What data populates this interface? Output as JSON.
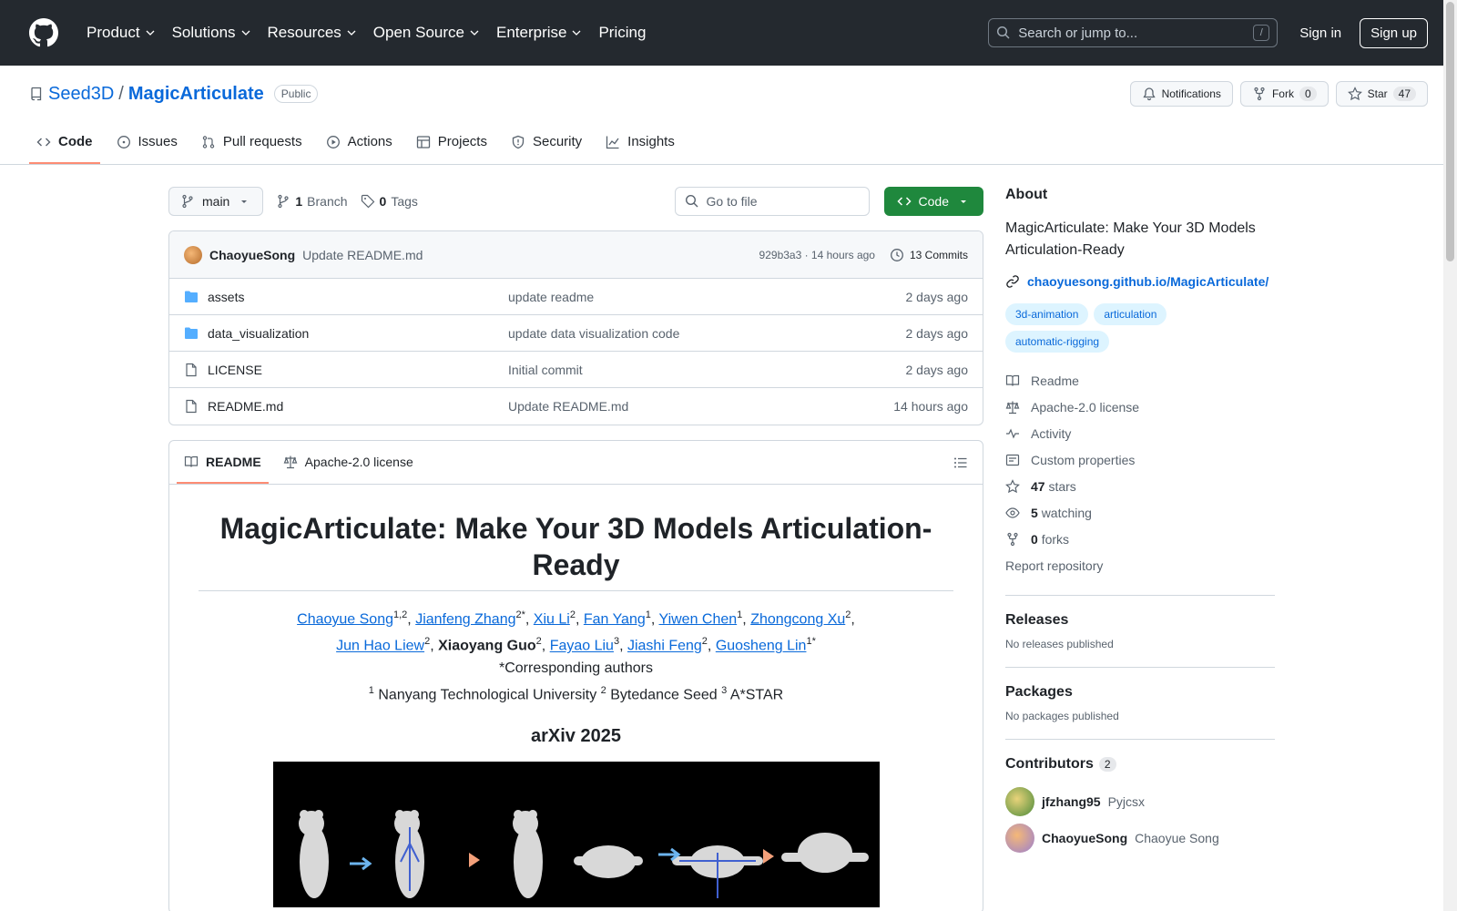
{
  "header": {
    "nav": [
      "Product",
      "Solutions",
      "Resources",
      "Open Source",
      "Enterprise",
      "Pricing"
    ],
    "search_placeholder": "Search or jump to...",
    "search_key": "/",
    "sign_in": "Sign in",
    "sign_up": "Sign up"
  },
  "repo": {
    "owner": "Seed3D",
    "sep": "/",
    "name": "MagicArticulate",
    "visibility": "Public",
    "notifications": "Notifications",
    "fork_label": "Fork",
    "fork_count": "0",
    "star_label": "Star",
    "star_count": "47"
  },
  "tabs": [
    "Code",
    "Issues",
    "Pull requests",
    "Actions",
    "Projects",
    "Security",
    "Insights"
  ],
  "filenav": {
    "branch": "main",
    "branch_count": "1",
    "branch_label": "Branch",
    "tag_count": "0",
    "tag_label": "Tags",
    "goto_placeholder": "Go to file",
    "code_button": "Code"
  },
  "commit": {
    "author": "ChaoyueSong",
    "message": "Update README.md",
    "sha_time": "929b3a3 · 14 hours ago",
    "commits": "13 Commits"
  },
  "files": [
    {
      "name": "assets",
      "type": "dir",
      "message": "update readme",
      "date": "2 days ago"
    },
    {
      "name": "data_visualization",
      "type": "dir",
      "message": "update data visualization code",
      "date": "2 days ago"
    },
    {
      "name": "LICENSE",
      "type": "file",
      "message": "Initial commit",
      "date": "2 days ago"
    },
    {
      "name": "README.md",
      "type": "file",
      "message": "Update README.md",
      "date": "14 hours ago"
    }
  ],
  "readme": {
    "tab_readme": "README",
    "tab_license": "Apache-2.0 license",
    "title": "MagicArticulate: Make Your 3D Models Articulation-Ready",
    "authors": [
      {
        "name": "Chaoyue Song",
        "sup": "1,2",
        "link": true
      },
      {
        "name": "Jianfeng Zhang",
        "sup": "2*",
        "link": true
      },
      {
        "name": "Xiu Li",
        "sup": "2",
        "link": true
      },
      {
        "name": "Fan Yang",
        "sup": "1",
        "link": true
      },
      {
        "name": "Yiwen Chen",
        "sup": "1",
        "link": true
      },
      {
        "name": "Zhongcong Xu",
        "sup": "2",
        "link": true
      },
      {
        "name": "Jun Hao Liew",
        "sup": "2",
        "link": true
      },
      {
        "name": "Xiaoyang Guo",
        "sup": "2",
        "link": false
      },
      {
        "name": "Fayao Liu",
        "sup": "3",
        "link": true
      },
      {
        "name": "Jiashi Feng",
        "sup": "2",
        "link": true
      },
      {
        "name": "Guosheng Lin",
        "sup": "1*",
        "link": true
      }
    ],
    "corresponding": "*Corresponding authors",
    "affiliations": [
      {
        "sup": "1",
        "name": "Nanyang Technological University"
      },
      {
        "sup": "2",
        "name": "Bytedance Seed"
      },
      {
        "sup": "3",
        "name": "A*STAR"
      }
    ],
    "venue": "arXiv 2025"
  },
  "about": {
    "heading": "About",
    "description": "MagicArticulate: Make Your 3D Models Articulation-Ready",
    "website": "chaoyuesong.github.io/MagicArticulate/",
    "topics": [
      "3d-animation",
      "articulation",
      "automatic-rigging"
    ],
    "links": [
      {
        "icon": "book-icon",
        "label": "Readme",
        "count": ""
      },
      {
        "icon": "law-icon",
        "label": "Apache-2.0 license",
        "count": ""
      },
      {
        "icon": "pulse-icon",
        "label": "Activity",
        "count": ""
      },
      {
        "icon": "note-icon",
        "label": "Custom properties",
        "count": ""
      },
      {
        "icon": "star-icon",
        "label": "stars",
        "count": "47"
      },
      {
        "icon": "eye-icon",
        "label": "watching",
        "count": "5"
      },
      {
        "icon": "fork-icon",
        "label": "forks",
        "count": "0"
      }
    ],
    "report": "Report repository"
  },
  "releases": {
    "heading": "Releases",
    "empty": "No releases published"
  },
  "packages": {
    "heading": "Packages",
    "empty": "No packages published"
  },
  "contributors": {
    "heading": "Contributors",
    "count": "2",
    "list": [
      {
        "login": "jfzhang95",
        "name": "Pyjcsx"
      },
      {
        "login": "ChaoyueSong",
        "name": "Chaoyue Song"
      }
    ]
  }
}
